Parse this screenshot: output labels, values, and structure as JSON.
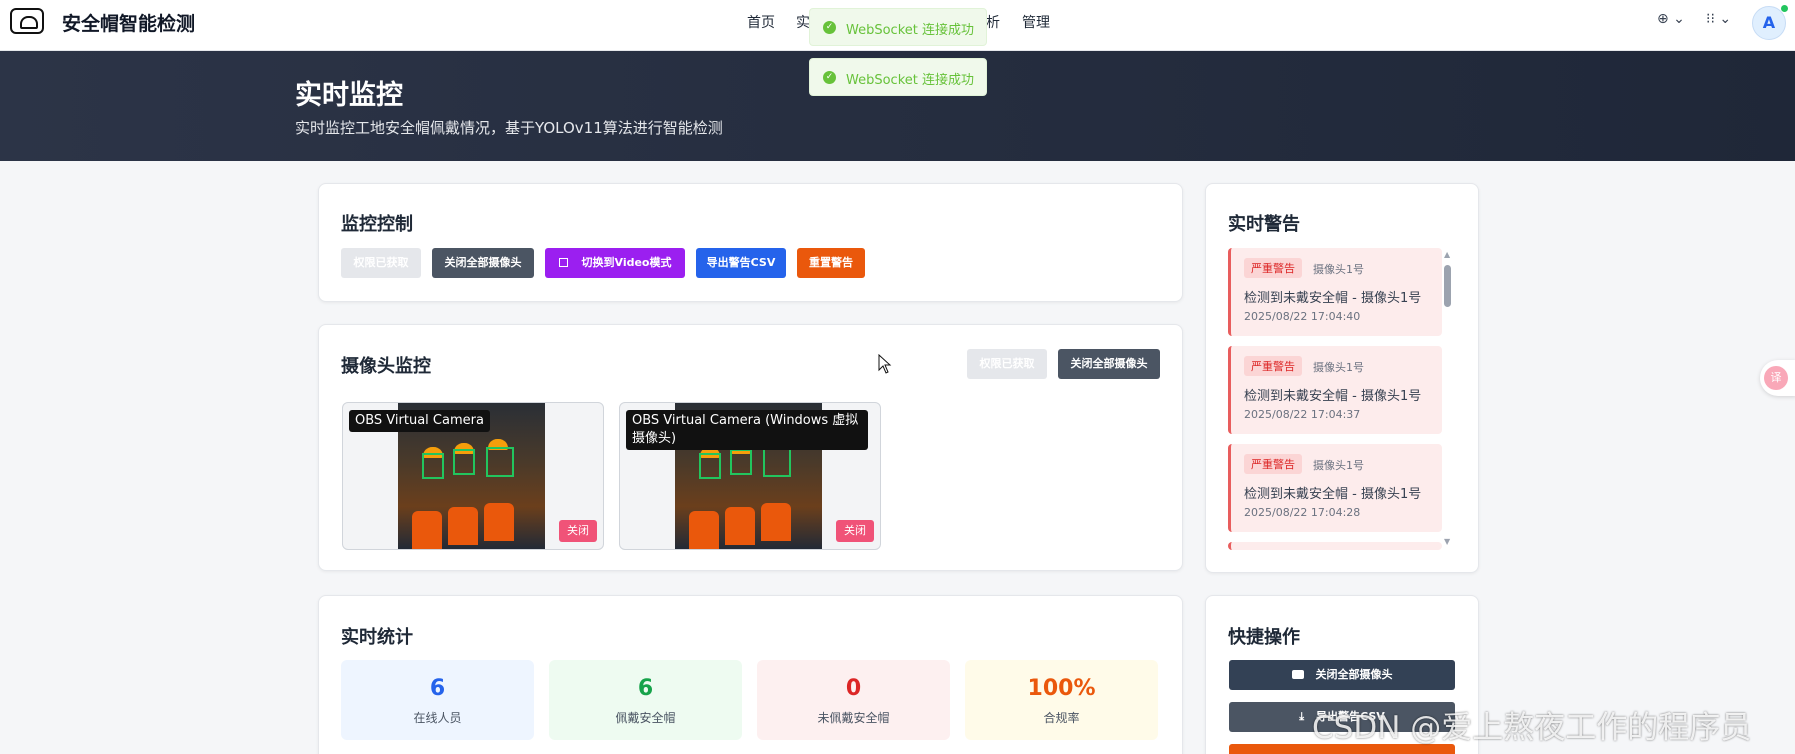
{
  "nav": {
    "brand": "安全帽智能检测",
    "links": [
      "首页",
      "实",
      "析",
      "管理"
    ],
    "lang_label": "⊕ ⌄",
    "apps_label": "⁝⁝ ⌄",
    "avatar_letter": "A"
  },
  "toasts": [
    "WebSocket 连接成功",
    "WebSocket 连接成功"
  ],
  "hero": {
    "title": "实时监控",
    "subtitle": "实时监控工地安全帽佩戴情况，基于YOLOv11算法进行智能检测"
  },
  "control": {
    "title": "监控控制",
    "buttons": [
      "权限已获取",
      "关闭全部摄像头",
      "切换到Video模式",
      "导出警告CSV",
      "重置警告"
    ]
  },
  "cameras": {
    "title": "摄像头监控",
    "buttons": [
      "权限已获取",
      "关闭全部摄像头"
    ],
    "items": [
      {
        "label": "OBS Virtual Camera",
        "close": "关闭"
      },
      {
        "label": "OBS Virtual Camera (Windows 虚拟摄像头)",
        "close": "关闭"
      }
    ]
  },
  "alerts": {
    "title": "实时警告",
    "items": [
      {
        "badge": "严重警告",
        "source": "摄像头1号",
        "message": "检测到未戴安全帽 - 摄像头1号",
        "time": "2025/08/22 17:04:40"
      },
      {
        "badge": "严重警告",
        "source": "摄像头1号",
        "message": "检测到未戴安全帽 - 摄像头1号",
        "time": "2025/08/22 17:04:37"
      },
      {
        "badge": "严重警告",
        "source": "摄像头1号",
        "message": "检测到未戴安全帽 - 摄像头1号",
        "time": "2025/08/22 17:04:28"
      }
    ]
  },
  "stats": {
    "title": "实时统计",
    "items": [
      {
        "value": "6",
        "label": "在线人员",
        "color": "#2563eb",
        "bg": "#eef5ff"
      },
      {
        "value": "6",
        "label": "佩戴安全帽",
        "color": "#16a34a",
        "bg": "#eefbf1"
      },
      {
        "value": "0",
        "label": "未佩戴安全帽",
        "color": "#dc2626",
        "bg": "#fdf0f0"
      },
      {
        "value": "100%",
        "label": "合规率",
        "color": "#ea580c",
        "bg": "#fffbe9"
      }
    ]
  },
  "quick": {
    "title": "快捷操作",
    "buttons": [
      "关闭全部摄像头",
      "导出警告CSV"
    ]
  },
  "side_float": "译",
  "watermark": "CSDN @爱上熬夜工作的程序员"
}
